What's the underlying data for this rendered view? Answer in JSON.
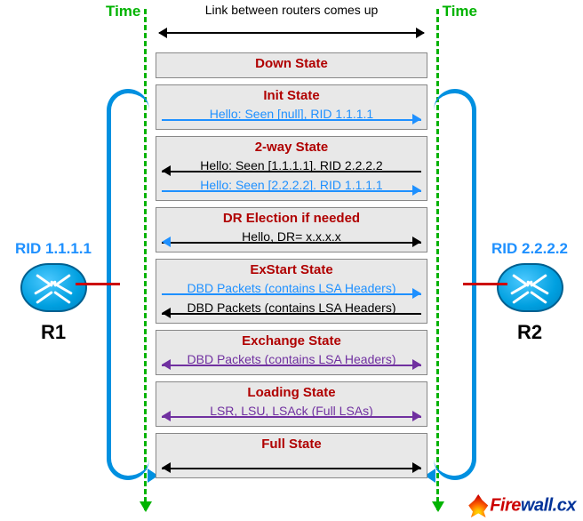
{
  "time_label": "Time",
  "linkup_text": "Link between routers comes up",
  "r1": {
    "rid": "RID 1.1.1.1",
    "name": "R1"
  },
  "r2": {
    "rid": "RID 2.2.2.2",
    "name": "R2"
  },
  "states": {
    "down": {
      "title": "Down State"
    },
    "init": {
      "title": "Init State",
      "msgs": [
        "Hello: Seen [null], RID 1.1.1.1"
      ]
    },
    "twoway": {
      "title": "2-way State",
      "msgs": [
        "Hello: Seen [1.1.1.1]. RID 2.2.2.2",
        "Hello: Seen [2.2.2.2]. RID 1.1.1.1"
      ]
    },
    "dr": {
      "title": "DR Election if needed",
      "msgs": [
        "Hello, DR= x.x.x.x"
      ]
    },
    "exstart": {
      "title": "ExStart State",
      "msgs": [
        "DBD Packets (contains LSA Headers)",
        "DBD Packets (contains LSA Headers)"
      ]
    },
    "exchange": {
      "title": "Exchange State",
      "msgs": [
        "DBD Packets (contains LSA Headers)"
      ]
    },
    "loading": {
      "title": "Loading State",
      "msgs": [
        "LSR, LSU, LSAck (Full LSAs)"
      ]
    },
    "full": {
      "title": "Full State"
    }
  },
  "watermark": {
    "fire": "Fire",
    "wall": "wall.cx"
  }
}
